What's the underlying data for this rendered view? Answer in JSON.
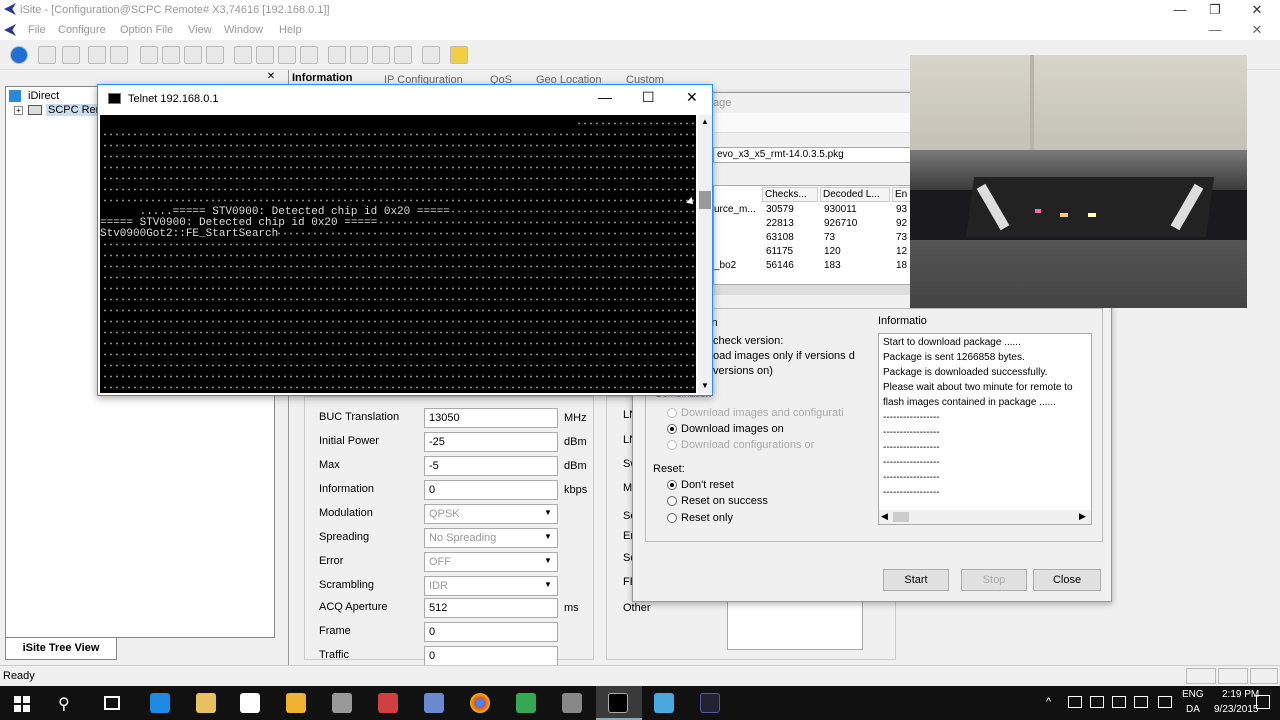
{
  "app": {
    "title": "iSite - [Configuration@SCPC Remote# X3,74616 [192.168.0.1]]"
  },
  "menu": [
    "File",
    "Configure",
    "Option File",
    "View",
    "Window",
    "Help"
  ],
  "tree": {
    "root": "iDirect",
    "child": "SCPC Remo",
    "tab": "iSite Tree View"
  },
  "tabs": [
    "Information",
    "IP Configuration",
    "QoS",
    "Geo Location",
    "Custom"
  ],
  "telnet": {
    "title": "Telnet 192.168.0.1",
    "lines": [
      "",
      "",
      "",
      "",
      "",
      "",
      "      .....===== STV0900: Detected chip id 0x20 =====",
      "===== STV0900: Detected chip id 0x20 =====",
      "Stv0900Got2::FE_StartSearch",
      "",
      "",
      "",
      "",
      "",
      "",
      "",
      "",
      "",
      "",
      "",
      "",
      "",
      "",
      "",
      "                                                 ===== STV0900: Detected",
      "chip id 0x20 =====",
      "Stv0900Got2::FE_StartSearch"
    ]
  },
  "config": {
    "fields": [
      {
        "label": "BUC Translation",
        "value": "13050",
        "unit": "MHz"
      },
      {
        "label": "Initial Power",
        "value": "-25",
        "unit": "dBm"
      },
      {
        "label": "Max",
        "value": "-5",
        "unit": "dBm"
      },
      {
        "label": "Information",
        "value": "0",
        "unit": "kbps"
      },
      {
        "label": "Modulation",
        "value": "QPSK",
        "unit": ""
      },
      {
        "label": "Spreading",
        "value": "No Spreading",
        "unit": ""
      },
      {
        "label": "Error",
        "value": "OFF",
        "unit": ""
      },
      {
        "label": "Scrambling",
        "value": "IDR",
        "unit": ""
      },
      {
        "label": "ACQ Aperture",
        "value": "512",
        "unit": "ms"
      },
      {
        "label": "Frame",
        "value": "0",
        "unit": ""
      },
      {
        "label": "Traffic",
        "value": "0",
        "unit": ""
      }
    ],
    "right_labels": [
      "LN",
      "LN",
      "Sw",
      "M",
      "Se",
      "En",
      "Sc",
      "FE",
      "Other"
    ]
  },
  "download": {
    "title_fragment": "age",
    "package": "evo_x3_x5_rmt-14.0.3.5.pkg",
    "columns": [
      "Checks...",
      "Decoded L...",
      "En"
    ],
    "rows": [
      {
        "name": "urce_m...",
        "checks": "30579",
        "decoded": "930011",
        "en": "93"
      },
      {
        "name": "",
        "checks": "22813",
        "decoded": "926710",
        "en": "92"
      },
      {
        "name": "",
        "checks": "63108",
        "decoded": "73",
        "en": "73"
      },
      {
        "name": "",
        "checks": "61175",
        "decoded": "120",
        "en": "12"
      },
      {
        "name": "_bo2",
        "checks": "56146",
        "decoded": "183",
        "en": "18"
      }
    ],
    "options_title": "ion",
    "check_version": "check version:",
    "only_if": "oad images only if versions d",
    "only_if2": "versions on)",
    "combination": "Combination",
    "radio1": [
      "Download images and configurati",
      "Download images on",
      "Download configurations or"
    ],
    "reset_label": "Reset:",
    "reset": [
      "Don't reset",
      "Reset on success",
      "Reset only"
    ],
    "info_title": "Informatio",
    "info_lines": [
      "Start to download package ......",
      "Package is sent 1266858 bytes.",
      "Package is downloaded successfully.",
      "Please wait about two minute for remote to",
      "flash images contained in package ......",
      "-----------------",
      "-----------------",
      "-----------------",
      "-----------------",
      "-----------------",
      "-----------------"
    ],
    "buttons": [
      "Start",
      "Stop",
      "Close"
    ]
  },
  "status": "Ready",
  "tray": {
    "lang": "ENG",
    "lang2": "DA",
    "time": "2:19 PM",
    "date": "9/23/2015"
  }
}
